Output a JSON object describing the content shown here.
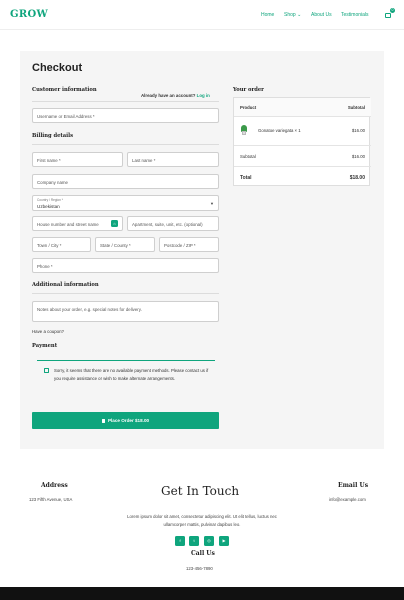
{
  "header": {
    "logo": "GROW",
    "nav": [
      "Home",
      "Shop ⌄",
      "About Us",
      "Testimonials"
    ],
    "cart_count": "0"
  },
  "checkout": {
    "title": "Checkout",
    "customer_info": "Customer information",
    "account_prompt": "Already have an account?",
    "login_label": "Log in",
    "username_placeholder": "Username or Email Address *",
    "billing_details": "Billing details",
    "first_name": "First name *",
    "last_name": "Last name *",
    "company": "Company name",
    "country_label": "Country / Region *",
    "country_value": "Uzbekistan",
    "street": "House number and street name",
    "apartment": "Apartment, suite, unit, etc. (optional)",
    "city": "Town / City *",
    "state": "State / County *",
    "postcode": "Postcode / ZIP *",
    "phone": "Phone *",
    "additional_info": "Additional information",
    "notes_placeholder": "Notes about your order, e.g. special notes for delivery.",
    "coupon": "Have a coupon?",
    "payment": "Payment",
    "payment_msg": "Sorry, it seems that there are no available payment methods. Please contact us if you require assistance or wish to make alternate arrangements.",
    "place_order": "Place Order $18.00"
  },
  "order": {
    "title": "Your order",
    "col_product": "Product",
    "col_subtotal": "Subtotal",
    "item_name": "Gonatoe variegata × 1",
    "item_price": "$16.00",
    "subtotal_label": "Subtotal",
    "subtotal_value": "$16.00",
    "total_label": "Total",
    "total_value": "$18.00"
  },
  "footer": {
    "address_title": "Address",
    "address": "123 Fifth Avenue, USA",
    "touch_title": "Get In Touch",
    "touch_text_1": "Lorem ipsum dolor sit amet, consectetur adipiscing elit. Ut elit tellus, luctus nec",
    "touch_text_2": "ullamcorper mattis, pulvinar dapibus leo.",
    "email_title": "Email Us",
    "email": "info@example.com",
    "call_title": "Call Us",
    "phone": "123-456-7890",
    "social_icons": [
      "facebook-icon",
      "twitter-icon",
      "instagram-icon",
      "youtube-icon"
    ]
  },
  "colors": {
    "accent": "#0fa57d",
    "panel": "#f5f5f5",
    "footer_bar": "#111111"
  }
}
